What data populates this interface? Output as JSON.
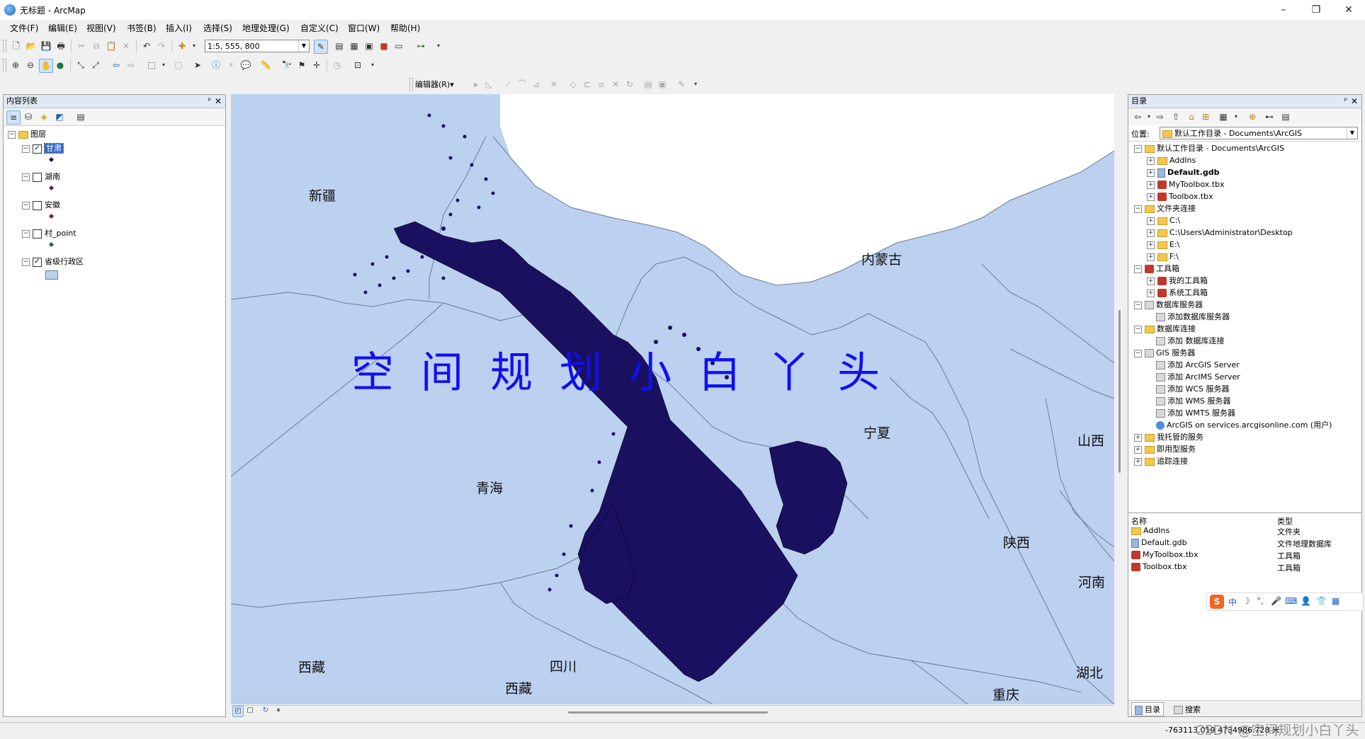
{
  "window": {
    "title": "无标题 - ArcMap",
    "minimize_glyph": "–",
    "restore_glyph": "❐",
    "close_glyph": "✕"
  },
  "menu": [
    "文件(F)",
    "编辑(E)",
    "视图(V)",
    "书签(B)",
    "插入(I)",
    "选择(S)",
    "地理处理(G)",
    "自定义(C)",
    "窗口(W)",
    "帮助(H)"
  ],
  "toolbar": {
    "scale_value": "1:5, 555, 800",
    "editor_label": "编辑器(R)",
    "editor_arrow": "▾"
  },
  "toc": {
    "title": "内容列表",
    "pin_glyph": "ᵖ",
    "close_glyph": "✕",
    "root": "图层",
    "layers": [
      {
        "name": "甘肃",
        "checked": true,
        "selected": true,
        "symbol": "point"
      },
      {
        "name": "湖南",
        "checked": false,
        "selected": false,
        "symbol": "point"
      },
      {
        "name": "安徽",
        "checked": false,
        "selected": false,
        "symbol": "point"
      },
      {
        "name": "村_point",
        "checked": false,
        "selected": false,
        "symbol": "point-green"
      },
      {
        "name": "省级行政区",
        "checked": true,
        "selected": false,
        "symbol": "polygon"
      }
    ]
  },
  "map": {
    "watermark": "空间规划小白丫头",
    "labels": [
      {
        "text": "新疆"
      },
      {
        "text": "内蒙古"
      },
      {
        "text": "宁夏"
      },
      {
        "text": "山西"
      },
      {
        "text": "青海"
      },
      {
        "text": "陕西"
      },
      {
        "text": "河南"
      },
      {
        "text": "西藏"
      },
      {
        "text": "四川"
      },
      {
        "text": "西藏"
      },
      {
        "text": "湖北"
      },
      {
        "text": "重庆"
      }
    ],
    "colors": {
      "background": "#bcd0f0",
      "land": "#c5d4ee",
      "points": "#1a1060"
    }
  },
  "catalog": {
    "title": "目录",
    "pin_glyph": "ᵖ",
    "close_glyph": "✕",
    "location_label": "位置:",
    "location_value": "默认工作目录 - Documents\\ArcGIS",
    "tree": [
      {
        "label": "默认工作目录 - Documents\\ArcGIS",
        "level": 0,
        "exp": "⊟",
        "icon": "fold",
        "bold": false
      },
      {
        "label": "AddIns",
        "level": 1,
        "exp": "⊞",
        "icon": "fold",
        "bold": false
      },
      {
        "label": "Default.gdb",
        "level": 1,
        "exp": "⊞",
        "icon": "gdb",
        "bold": true
      },
      {
        "label": "MyToolbox.tbx",
        "level": 1,
        "exp": "⊞",
        "icon": "tbx",
        "bold": false
      },
      {
        "label": "Toolbox.tbx",
        "level": 1,
        "exp": "⊞",
        "icon": "tbx",
        "bold": false
      },
      {
        "label": "文件夹连接",
        "level": 0,
        "exp": "⊟",
        "icon": "fold",
        "bold": false
      },
      {
        "label": "C:\\",
        "level": 1,
        "exp": "⊞",
        "icon": "fold",
        "bold": false
      },
      {
        "label": "C:\\Users\\Administrator\\Desktop",
        "level": 1,
        "exp": "⊞",
        "icon": "fold",
        "bold": false
      },
      {
        "label": "E:\\",
        "level": 1,
        "exp": "⊞",
        "icon": "fold",
        "bold": false
      },
      {
        "label": "F:\\",
        "level": 1,
        "exp": "⊞",
        "icon": "fold",
        "bold": false
      },
      {
        "label": "工具箱",
        "level": 0,
        "exp": "⊟",
        "icon": "tbx",
        "bold": false
      },
      {
        "label": "我的工具箱",
        "level": 1,
        "exp": "⊞",
        "icon": "tbx",
        "bold": false
      },
      {
        "label": "系统工具箱",
        "level": 1,
        "exp": "⊞",
        "icon": "tbx",
        "bold": false
      },
      {
        "label": "数据库服务器",
        "level": 0,
        "exp": "⊟",
        "icon": "srv",
        "bold": false
      },
      {
        "label": "添加数据库服务器",
        "level": 1,
        "exp": "",
        "icon": "srv",
        "bold": false
      },
      {
        "label": "数据库连接",
        "level": 0,
        "exp": "⊟",
        "icon": "fold",
        "bold": false
      },
      {
        "label": "添加 数据库连接",
        "level": 1,
        "exp": "",
        "icon": "srv",
        "bold": false
      },
      {
        "label": "GIS 服务器",
        "level": 0,
        "exp": "⊟",
        "icon": "srv",
        "bold": false
      },
      {
        "label": "添加 ArcGIS Server",
        "level": 1,
        "exp": "",
        "icon": "srv",
        "bold": false
      },
      {
        "label": "添加 ArcIMS Server",
        "level": 1,
        "exp": "",
        "icon": "srv",
        "bold": false
      },
      {
        "label": "添加 WCS 服务器",
        "level": 1,
        "exp": "",
        "icon": "srv",
        "bold": false
      },
      {
        "label": "添加 WMS 服务器",
        "level": 1,
        "exp": "",
        "icon": "srv",
        "bold": false
      },
      {
        "label": "添加 WMTS 服务器",
        "level": 1,
        "exp": "",
        "icon": "srv",
        "bold": false
      },
      {
        "label": "ArcGIS on services.arcgisonline.com (用户)",
        "level": 1,
        "exp": "",
        "icon": "globe",
        "bold": false
      },
      {
        "label": "我托管的服务",
        "level": 0,
        "exp": "⊞",
        "icon": "fold",
        "bold": false
      },
      {
        "label": "即用型服务",
        "level": 0,
        "exp": "⊞",
        "icon": "fold",
        "bold": false
      },
      {
        "label": "追踪连接",
        "level": 0,
        "exp": "⊞",
        "icon": "fold",
        "bold": false
      }
    ],
    "list_headers": [
      "名称",
      "类型"
    ],
    "list_rows": [
      {
        "name": "AddIns",
        "type": "文件夹",
        "icon": "fold"
      },
      {
        "name": "Default.gdb",
        "type": "文件地理数据库",
        "icon": "gdb"
      },
      {
        "name": "MyToolbox.tbx",
        "type": "工具箱",
        "icon": "tbx"
      },
      {
        "name": "Toolbox.tbx",
        "type": "工具箱",
        "icon": "tbx"
      }
    ],
    "tabs": [
      "目录",
      "搜索"
    ]
  },
  "ime": {
    "logo": "S",
    "lang": "中"
  },
  "status": {
    "coords": "-763113.019  4734986.728 米",
    "watermark": "CSDN @空间规划小白丫头"
  }
}
